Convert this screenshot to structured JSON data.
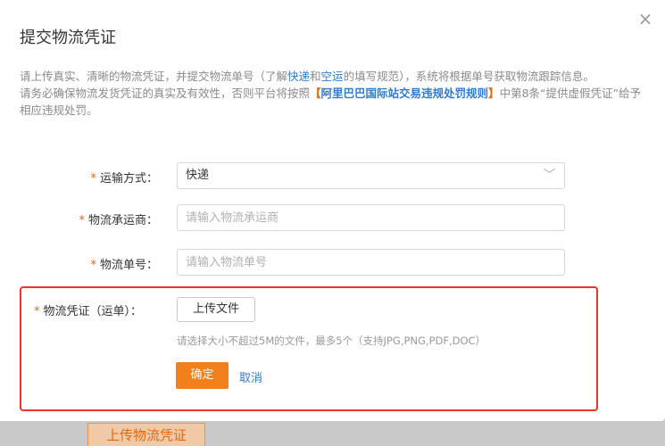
{
  "dialog": {
    "title": "提交物流凭证",
    "close_glyph": "×",
    "close_icon": "close-icon"
  },
  "notice": {
    "line1_prefix": "请上传真实、清晰的物流凭证，并提交物流单号（了解",
    "link_express": "快递",
    "conj": "和",
    "link_air": "空运",
    "line1_suffix": "的填写规范），系统将根据单号获取物流跟踪信息。",
    "line2_prefix": "请务必确保物流发货凭证的真实及有效性，否则平台将按照",
    "bracket_open": "【",
    "rule_link": "阿里巴巴国际站交易违规处罚规则",
    "bracket_close": "】",
    "line2_suffix": "中第8条“提供虚假凭证”给予相应违规处罚。"
  },
  "form": {
    "required_mark": "*",
    "shipping_method": {
      "label": "运输方式：",
      "value": "快递",
      "chevron": "﹀",
      "chevron_icon": "chevron-down-icon"
    },
    "carrier": {
      "label": "物流承运商：",
      "value": "",
      "placeholder": "请输入物流承运商"
    },
    "tracking_number": {
      "label": "物流单号：",
      "value": "",
      "placeholder": "请输入物流单号"
    },
    "proof": {
      "label": "物流凭证（运单）：",
      "upload_label": "上传文件",
      "hint": "请选择大小不超过5M的文件，最多5个（支持JPG,PNG,PDF,DOC）"
    }
  },
  "actions": {
    "confirm_label": "确定",
    "cancel_label": "取消"
  },
  "backdrop": {
    "button_label": "上传物流凭证"
  },
  "colors": {
    "accent_orange": "#f07f1c",
    "link_blue": "#2f7bd1",
    "highlight_red": "#e8362d"
  }
}
